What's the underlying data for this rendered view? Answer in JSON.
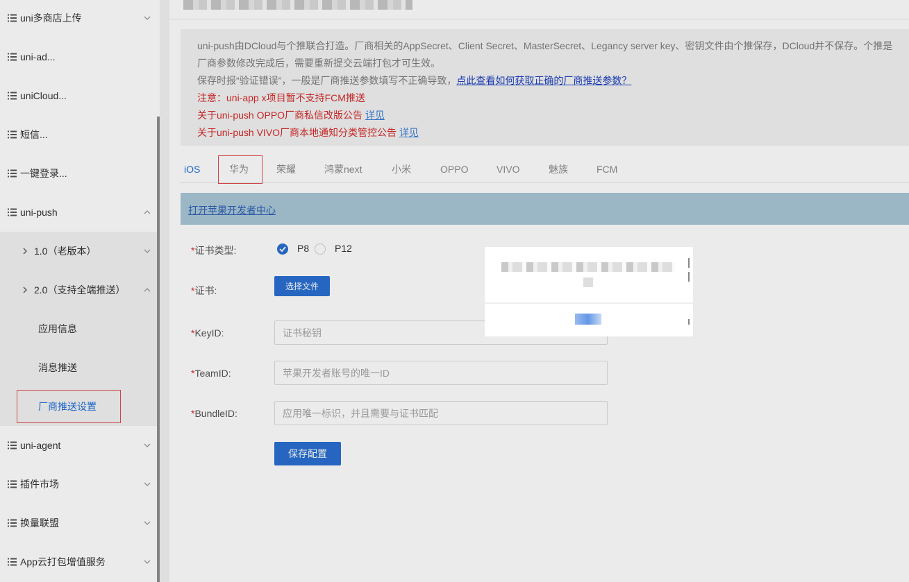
{
  "sidebar": {
    "items": [
      {
        "label": "uni多商店上传"
      },
      {
        "label": "uni-ad..."
      },
      {
        "label": "uniCloud..."
      },
      {
        "label": "短信..."
      },
      {
        "label": "一键登录..."
      },
      {
        "label": "uni-push"
      },
      {
        "label": "uni-agent"
      },
      {
        "label": "插件市场"
      },
      {
        "label": "换量联盟"
      },
      {
        "label": "App云打包增值服务"
      }
    ],
    "sub_items": [
      {
        "label": "1.0（老版本）"
      },
      {
        "label": "2.0（支持全端推送）"
      }
    ],
    "leaf_items": [
      {
        "label": "应用信息"
      },
      {
        "label": "消息推送"
      },
      {
        "label": "厂商推送设置"
      }
    ]
  },
  "notice": {
    "line1": "uni-push由DCloud与个推联合打造。厂商相关的AppSecret、Client Secret、MasterSecret、Legancy server key、密钥文件由个推保存，DCloud并不保存。个推是",
    "line2": "厂商参数修改完成后，需要重新提交云端打包才可生效。",
    "line3_text": "保存时报“验证错误”，一般是厂商推送参数填写不正确导致，",
    "line3_link": "点此查看如何获取正确的厂商推送参数？",
    "line4": "注意：uni-app x项目暂不支持FCM推送",
    "line5_text": "关于uni-push OPPO厂商私信改版公告 ",
    "line5_link": "详见",
    "line6_text": "关于uni-push VIVO厂商本地通知分类管控公告 ",
    "line6_link": "详见"
  },
  "tabs": [
    "iOS",
    "华为",
    "荣耀",
    "鸿蒙next",
    "小米",
    "OPPO",
    "VIVO",
    "魅族",
    "FCM"
  ],
  "link_bar": {
    "label": "打开苹果开发者中心"
  },
  "form": {
    "cert_type_label": "证书类型:",
    "cert_type_options": [
      "P8",
      "P12"
    ],
    "cert_type_selected": "P8",
    "cert_label": "证书:",
    "choose_file_button": "选择文件",
    "keyid_label": "KeyID:",
    "keyid_placeholder": "证书秘钥",
    "teamid_label": "TeamID:",
    "teamid_placeholder": "苹果开发者账号的唯一ID",
    "bundleid_label": "BundleID:",
    "bundleid_placeholder": "应用唯一标识，并且需要与证书匹配",
    "required_mark": "*",
    "save_button": "保存配置"
  },
  "colors": {
    "accent": "#2a6fd2",
    "active_text": "#1e6fd9",
    "warning_red": "#d62b2b",
    "highlight_box": "#e24a4a"
  }
}
